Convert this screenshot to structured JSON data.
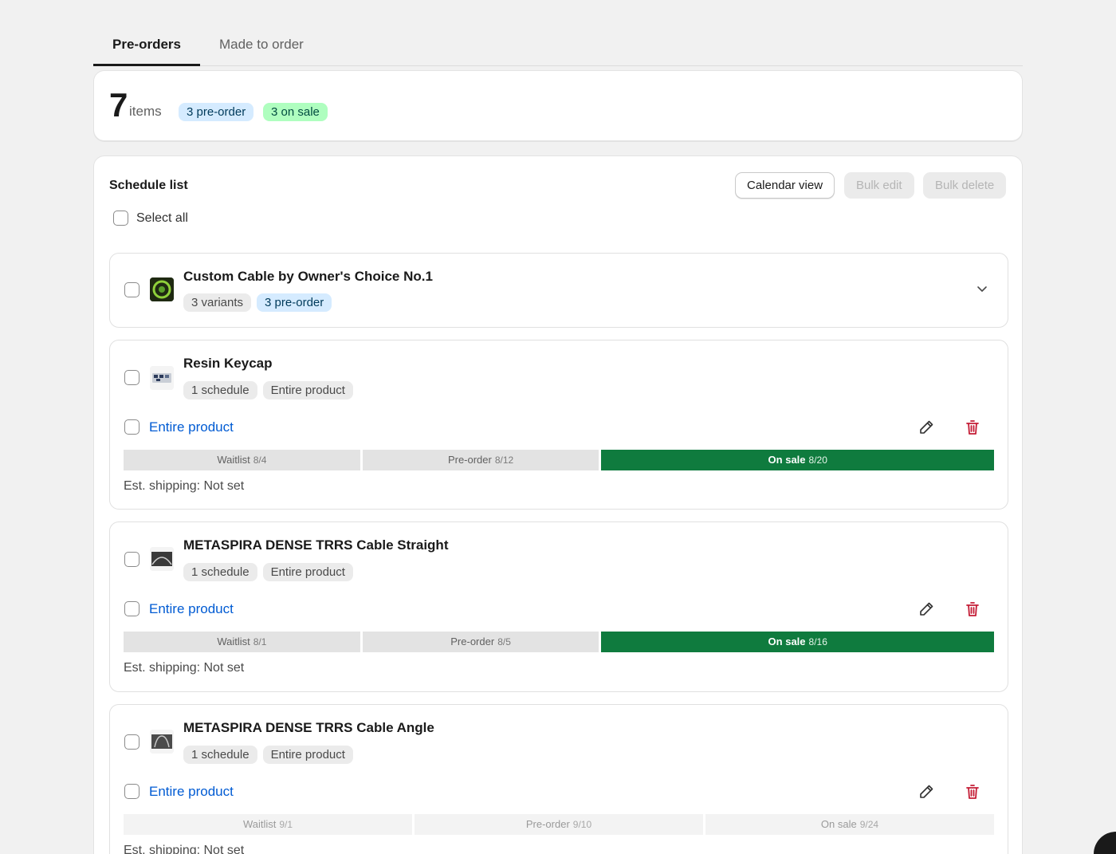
{
  "tabs": [
    {
      "label": "Pre-orders",
      "active": true
    },
    {
      "label": "Made to order",
      "active": false
    }
  ],
  "summary": {
    "count": "7",
    "items_label": "items",
    "badge_preorder": "3 pre-order",
    "badge_onsale": "3 on sale"
  },
  "schedule": {
    "title": "Schedule list",
    "calendar_view": "Calendar view",
    "bulk_edit": "Bulk edit",
    "bulk_delete": "Bulk delete",
    "select_all": "Select all"
  },
  "products": [
    {
      "name": "Custom Cable by Owner's Choice No.1",
      "badges": [
        "3 variants",
        "3 pre-order"
      ],
      "collapsed": true
    },
    {
      "name": "Resin Keycap",
      "badges": [
        "1 schedule",
        "Entire product"
      ],
      "variant_label": "Entire product",
      "timeline": {
        "waitlist_label": "Waitlist",
        "waitlist_date": "8/4",
        "preorder_label": "Pre-order",
        "preorder_date": "8/12",
        "onsale_label": "On sale",
        "onsale_date": "8/20"
      },
      "shipping": "Est. shipping: Not set"
    },
    {
      "name": "METASPIRA DENSE TRRS Cable Straight",
      "badges": [
        "1 schedule",
        "Entire product"
      ],
      "variant_label": "Entire product",
      "timeline": {
        "waitlist_label": "Waitlist",
        "waitlist_date": "8/1",
        "preorder_label": "Pre-order",
        "preorder_date": "8/5",
        "onsale_label": "On sale",
        "onsale_date": "8/16"
      },
      "shipping": "Est. shipping: Not set"
    },
    {
      "name": "METASPIRA DENSE TRRS Cable Angle",
      "badges": [
        "1 schedule",
        "Entire product"
      ],
      "variant_label": "Entire product",
      "timeline": {
        "waitlist_label": "Waitlist",
        "waitlist_date": "9/1",
        "preorder_label": "Pre-order",
        "preorder_date": "9/10",
        "onsale_label": "On sale",
        "onsale_date": "9/24"
      },
      "shipping": "Est. shipping: Not set"
    }
  ],
  "colors": {
    "onsale": "#0f7b3e",
    "link": "#005bd3",
    "delete": "#c41c35",
    "badge_blue": "#d5ebff",
    "badge_green": "#affebf"
  }
}
